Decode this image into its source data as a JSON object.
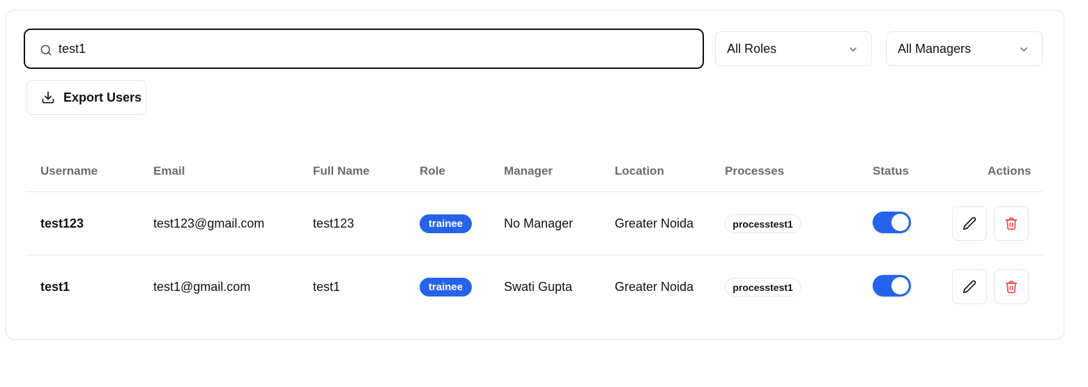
{
  "search": {
    "value": "test1",
    "icon": "search-icon"
  },
  "filters": {
    "role": {
      "selected": "All Roles"
    },
    "manager": {
      "selected": "All Managers"
    }
  },
  "toolbar": {
    "export_label": "Export Users"
  },
  "table": {
    "headers": {
      "username": "Username",
      "email": "Email",
      "full_name": "Full Name",
      "role": "Role",
      "manager": "Manager",
      "location": "Location",
      "processes": "Processes",
      "status": "Status",
      "actions": "Actions"
    },
    "rows": [
      {
        "username": "test123",
        "email": "test123@gmail.com",
        "full_name": "test123",
        "role": "trainee",
        "manager": "No Manager",
        "location": "Greater Noida",
        "process": "processtest1",
        "active": true
      },
      {
        "username": "test1",
        "email": "test1@gmail.com",
        "full_name": "test1",
        "role": "trainee",
        "manager": "Swati Gupta",
        "location": "Greater Noida",
        "process": "processtest1",
        "active": true
      }
    ]
  },
  "colors": {
    "accent": "#2563eb",
    "danger": "#ef4444",
    "border": "#e5e7eb",
    "header_text": "#6b6b6b"
  }
}
